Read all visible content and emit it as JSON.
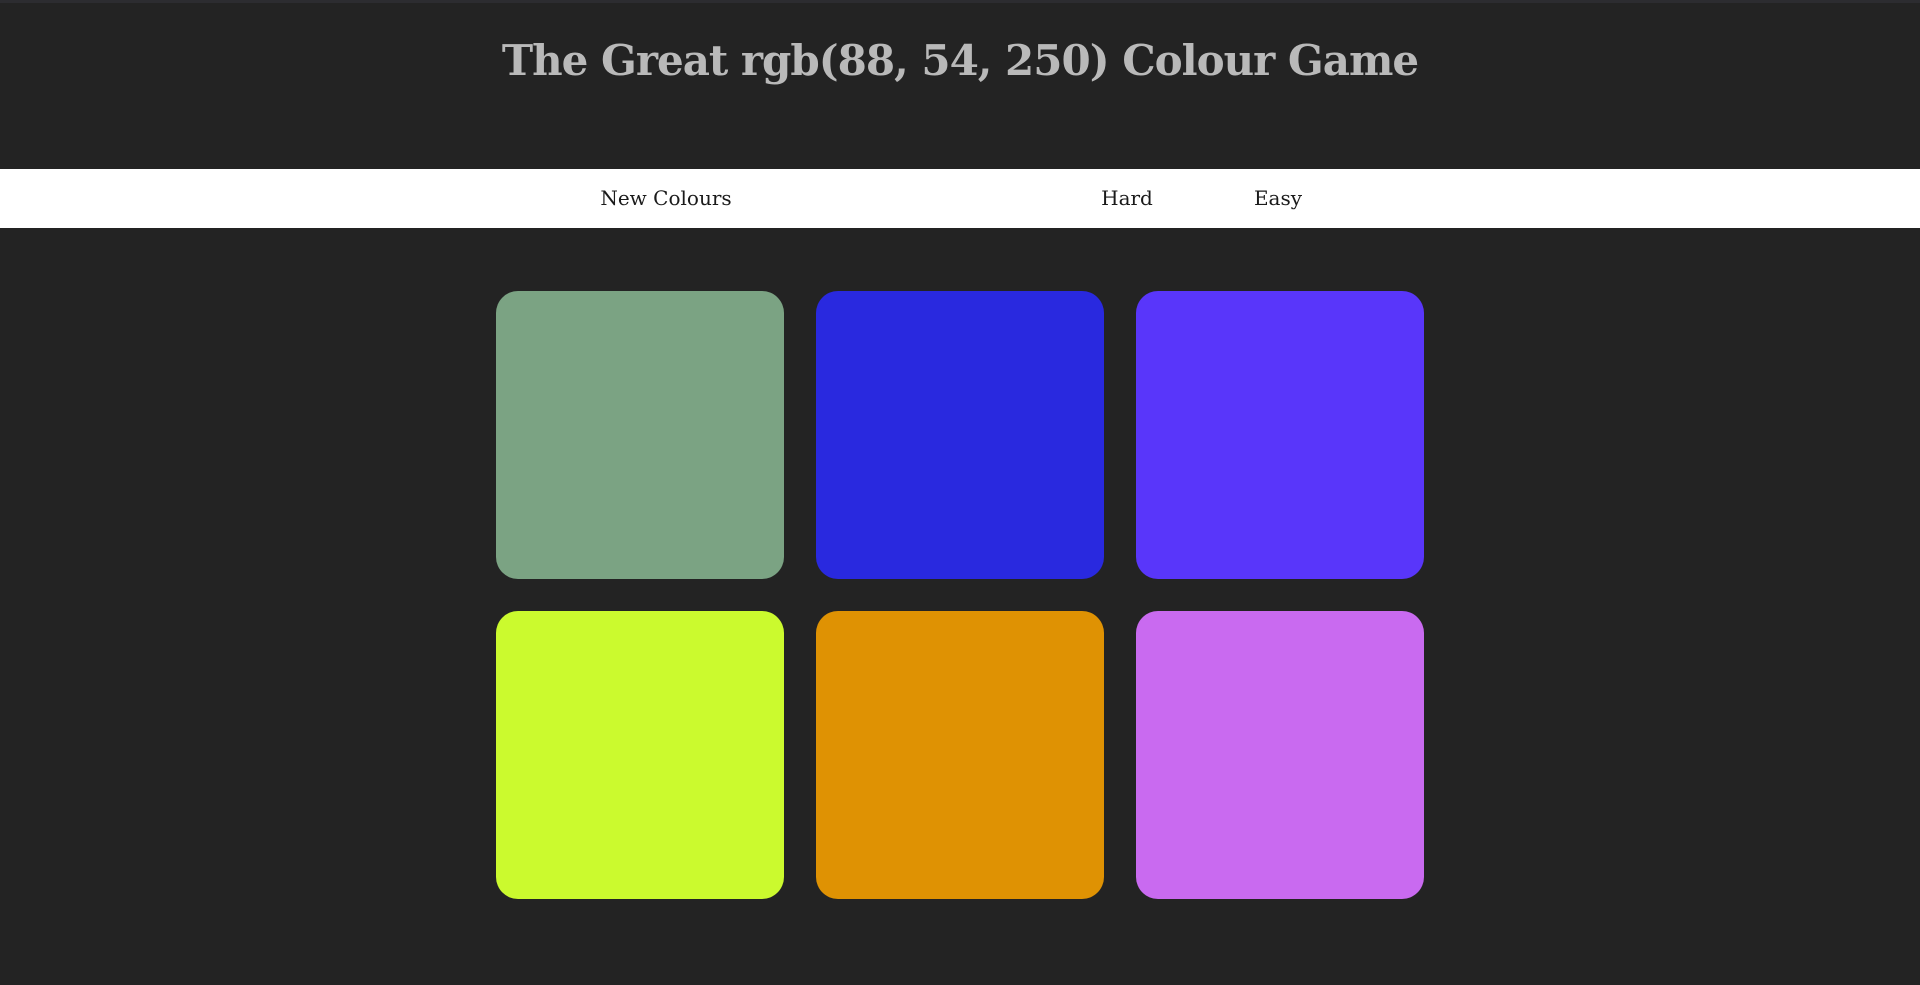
{
  "header": {
    "title": "The Great rgb(88, 54, 250) Colour Game"
  },
  "controls": {
    "new_colours_label": "New Colours",
    "hard_label": "Hard",
    "easy_label": "Easy"
  },
  "theme": {
    "background": "#232323",
    "title_color": "#b9b9b9",
    "stripe_background": "#ffffff",
    "stripe_text": "#1a1a1a"
  },
  "squares": [
    {
      "color": "#7ba383"
    },
    {
      "color": "#2929df"
    },
    {
      "color": "#5936fa"
    },
    {
      "color": "#cbfa2e"
    },
    {
      "color": "#df9203"
    },
    {
      "color": "#c96af0"
    }
  ]
}
